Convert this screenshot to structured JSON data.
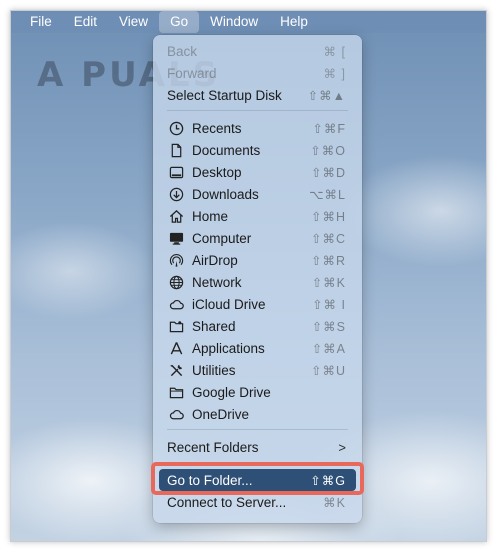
{
  "menubar": {
    "items": [
      "File",
      "Edit",
      "View",
      "Go",
      "Window",
      "Help"
    ],
    "active": "Go"
  },
  "watermark": {
    "text": "A PUALS"
  },
  "menu": {
    "items": {
      "back": {
        "label": "Back",
        "shortcut": "⌘ ["
      },
      "forward": {
        "label": "Forward",
        "shortcut": "⌘ ]"
      },
      "startup": {
        "label": "Select Startup Disk",
        "shortcut": "⇧⌘▲"
      },
      "recents": {
        "label": "Recents",
        "shortcut": "⇧⌘F",
        "icon": "clock-icon"
      },
      "documents": {
        "label": "Documents",
        "shortcut": "⇧⌘O",
        "icon": "document-icon"
      },
      "desktop": {
        "label": "Desktop",
        "shortcut": "⇧⌘D",
        "icon": "desktop-icon"
      },
      "downloads": {
        "label": "Downloads",
        "shortcut": "⌥⌘L",
        "icon": "download-icon"
      },
      "home": {
        "label": "Home",
        "shortcut": "⇧⌘H",
        "icon": "home-icon"
      },
      "computer": {
        "label": "Computer",
        "shortcut": "⇧⌘C",
        "icon": "computer-icon"
      },
      "airdrop": {
        "label": "AirDrop",
        "shortcut": "⇧⌘R",
        "icon": "airdrop-icon"
      },
      "network": {
        "label": "Network",
        "shortcut": "⇧⌘K",
        "icon": "network-globe-icon"
      },
      "icloud": {
        "label": "iCloud Drive",
        "shortcut": "⇧⌘ I",
        "icon": "cloud-icon"
      },
      "shared": {
        "label": "Shared",
        "shortcut": "⇧⌘S",
        "icon": "shared-folder-icon"
      },
      "applications": {
        "label": "Applications",
        "shortcut": "⇧⌘A",
        "icon": "applications-icon"
      },
      "utilities": {
        "label": "Utilities",
        "shortcut": "⇧⌘U",
        "icon": "tools-icon"
      },
      "googledrive": {
        "label": "Google Drive",
        "icon": "folder-icon"
      },
      "onedrive": {
        "label": "OneDrive",
        "icon": "cloud-icon"
      },
      "recentfolders": {
        "label": "Recent Folders",
        "chevron": ">"
      },
      "gotofolder": {
        "label": "Go to Folder...",
        "shortcut": "⇧⌘G"
      },
      "connect": {
        "label": "Connect to Server...",
        "shortcut": "⌘K"
      }
    }
  },
  "colors": {
    "highlight": "#2e4f76",
    "annotation_box": "#e8695b",
    "menu_background": "#c8d8ec"
  }
}
